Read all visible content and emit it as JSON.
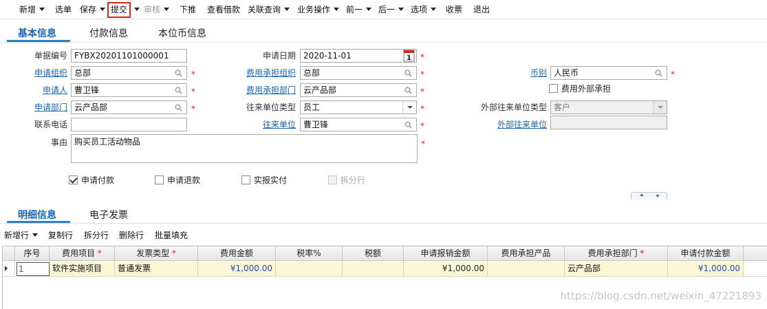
{
  "toolbar": {
    "items": [
      {
        "label": "新增",
        "caret": true
      },
      {
        "label": "选单",
        "caret": false
      },
      {
        "label": "保存",
        "caret": true
      },
      {
        "label": "提交",
        "caret": true,
        "highlighted": true
      },
      {
        "label": "审核",
        "caret": true,
        "disabled": true
      },
      {
        "label": "下推",
        "caret": false
      },
      {
        "label": "查看借款",
        "caret": false
      },
      {
        "label": "关联查询",
        "caret": true
      },
      {
        "label": "业务操作",
        "caret": true
      },
      {
        "label": "前一",
        "caret": true
      },
      {
        "label": "后一",
        "caret": true
      },
      {
        "label": "选项",
        "caret": true
      },
      {
        "label": "收票",
        "caret": false
      },
      {
        "label": "退出",
        "caret": false
      }
    ]
  },
  "tabs": [
    {
      "label": "基本信息",
      "active": true
    },
    {
      "label": "付款信息",
      "active": false
    },
    {
      "label": "本位币信息",
      "active": false
    }
  ],
  "form": {
    "bill_no_label": "单据编号",
    "bill_no": "FYBX20201101000001",
    "apply_date_label": "申请日期",
    "apply_date": "2020-11-01",
    "calendar_day": "1",
    "apply_org_label": "申请组织",
    "apply_org": "总部",
    "cost_org_label": "费用承担组织",
    "cost_org": "总部",
    "currency_label": "币别",
    "currency": "人民币",
    "applicant_label": "申请人",
    "applicant": "曹卫锋",
    "cost_dept_label": "费用承担部门",
    "cost_dept": "云产品部",
    "external_cost_label": "费用外部承担",
    "apply_dept_label": "申请部门",
    "apply_dept": "云产品部",
    "contact_type_label": "往来单位类型",
    "contact_type": "员工",
    "ext_contact_type_label": "外部往来单位类型",
    "ext_contact_type": "客户",
    "phone_label": "联系电话",
    "phone": "",
    "contact_unit_label": "往来单位",
    "contact_unit": "曹卫锋",
    "ext_contact_unit_label": "外部往来单位",
    "ext_contact_unit": "",
    "reason_label": "事由",
    "reason": "购买员工活动物品",
    "required_mark": "*"
  },
  "checks": [
    {
      "label": "申请付款",
      "checked": true,
      "disabled": false
    },
    {
      "label": "申请退款",
      "checked": false,
      "disabled": false
    },
    {
      "label": "实报实付",
      "checked": false,
      "disabled": false
    },
    {
      "label": "拆分行",
      "checked": false,
      "disabled": true
    }
  ],
  "detail_tabs": [
    {
      "label": "明细信息",
      "active": true
    },
    {
      "label": "电子发票",
      "active": false
    }
  ],
  "detail_toolbar": [
    {
      "label": "新增行",
      "caret": true
    },
    {
      "label": "复制行",
      "caret": false
    },
    {
      "label": "拆分行",
      "caret": false
    },
    {
      "label": "删除行",
      "caret": false
    },
    {
      "label": "批量填充",
      "caret": false
    }
  ],
  "grid": {
    "columns": [
      {
        "label": "序号",
        "required": false
      },
      {
        "label": "费用项目",
        "required": true
      },
      {
        "label": "发票类型",
        "required": true
      },
      {
        "label": "费用金额",
        "required": false
      },
      {
        "label": "税率%",
        "required": false
      },
      {
        "label": "税额",
        "required": false
      },
      {
        "label": "申请报销金额",
        "required": false
      },
      {
        "label": "费用承担产品",
        "required": false
      },
      {
        "label": "费用承担部门",
        "required": true
      },
      {
        "label": "申请付款金额",
        "required": false
      }
    ],
    "rows": [
      {
        "seq": "1",
        "item": "软件实施项目",
        "invoice_type": "普通发票",
        "amount": "¥1,000.00",
        "tax_rate": "",
        "tax": "",
        "apply_amount": "¥1,000.00",
        "product": "",
        "dept": "云产品部",
        "pay_amount": "¥1,000.00"
      }
    ]
  },
  "watermark": "https://blog.csdn.net/weixin_47221893",
  "colors": {
    "link": "#1a66b5",
    "required": "#d9261c",
    "row_bg": "#fdf6d6",
    "tab_accent": "#2b7cd3"
  }
}
